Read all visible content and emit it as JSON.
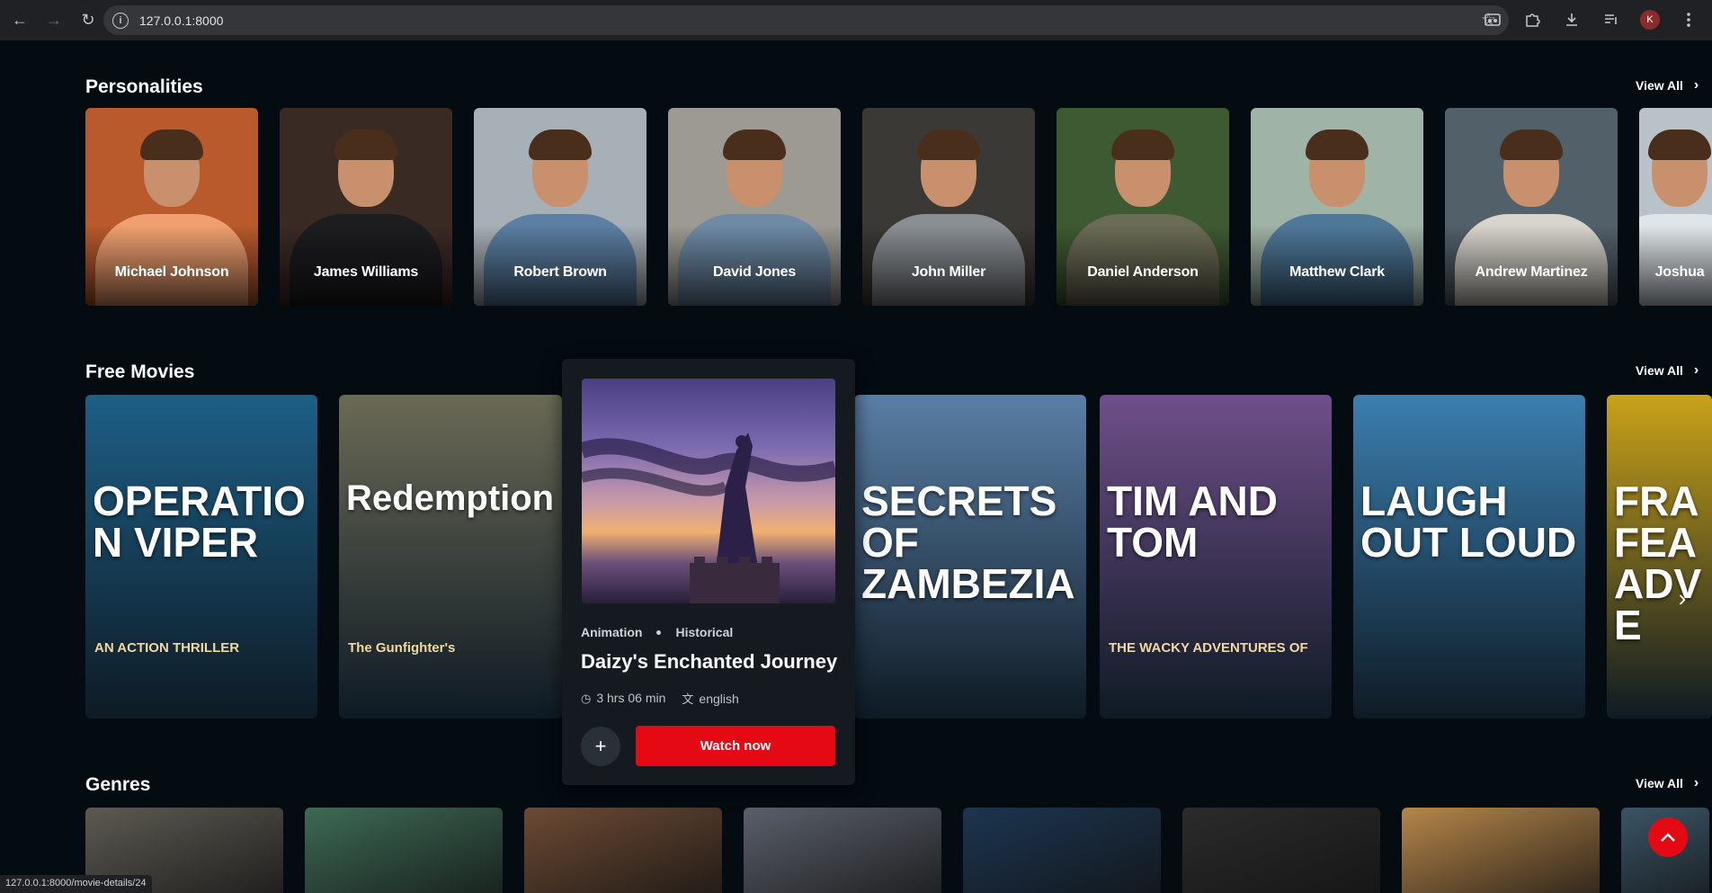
{
  "browser": {
    "url": "127.0.0.1:8000",
    "profile_initial": "K",
    "status_url": "127.0.0.1:8000/movie-details/24"
  },
  "personalities": {
    "title": "Personalities",
    "view_all": "View All",
    "people": [
      {
        "name": "Michael Johnson",
        "bg": "#b85a2c",
        "shirt": "#f0a070"
      },
      {
        "name": "James Williams",
        "bg": "#3a2a24",
        "shirt": "#1d1d20"
      },
      {
        "name": "Robert Brown",
        "bg": "#a7b0b6",
        "shirt": "#5c7fa3"
      },
      {
        "name": "David Jones",
        "bg": "#9c9a92",
        "shirt": "#6e8aa5"
      },
      {
        "name": "John Miller",
        "bg": "#3b3936",
        "shirt": "#8a8f94"
      },
      {
        "name": "Daniel Anderson",
        "bg": "#3e5a32",
        "shirt": "#6b6c56"
      },
      {
        "name": "Matthew Clark",
        "bg": "#9fb3a6",
        "shirt": "#4f7898"
      },
      {
        "name": "Andrew Martinez",
        "bg": "#52606a",
        "shirt": "#d8d5cc"
      },
      {
        "name": "Joshua",
        "bg": "#b9c2c8",
        "shirt": "#dfe6ea"
      }
    ]
  },
  "free_movies": {
    "title": "Free Movies",
    "view_all": "View All",
    "movies": [
      {
        "title_line": "OPERATION VIPER",
        "sub": "AN ACTION THRILLER",
        "bg": "#1d5f86"
      },
      {
        "title_line": "Redemption",
        "sub": "The Gunfighter's",
        "bg": "#6a6a56"
      },
      {
        "title_line": "SECRETS OF ZAMBEZIA",
        "sub": "",
        "bg": "#5a7fa6"
      },
      {
        "title_line": "TIM AND TOM",
        "sub": "THE WACKY ADVENTURES OF",
        "bg": "#6f4f8a"
      },
      {
        "title_line": "LAUGH OUT LOUD",
        "sub": "",
        "bg": "#3b7fb0"
      },
      {
        "title_line": "FRA FEA ADVE",
        "sub": "",
        "bg": "#c9a21a"
      }
    ]
  },
  "popup": {
    "genre_1": "Animation",
    "genre_2": "Historical",
    "title": "Daizy's Enchanted Journey",
    "duration": "3 hrs 06 min",
    "language": "english",
    "add_symbol": "+",
    "watch_label": "Watch now"
  },
  "genres": {
    "title": "Genres",
    "view_all": "View All",
    "tiles": [
      {
        "bg": "#5c5a52"
      },
      {
        "bg": "#3d6a55"
      },
      {
        "bg": "#6b4a34"
      },
      {
        "bg": "#5a5f6a"
      },
      {
        "bg": "#1c3550"
      },
      {
        "bg": "#2b2b2b"
      },
      {
        "bg": "#b5864a"
      },
      {
        "bg": "#3a5566"
      }
    ]
  },
  "icons": {
    "back": "←",
    "forward": "→",
    "reload": "↻",
    "info": "i",
    "star": "☆",
    "chevron_right": "›",
    "chevron_up": "^",
    "clock": "◷",
    "translate": "文"
  }
}
